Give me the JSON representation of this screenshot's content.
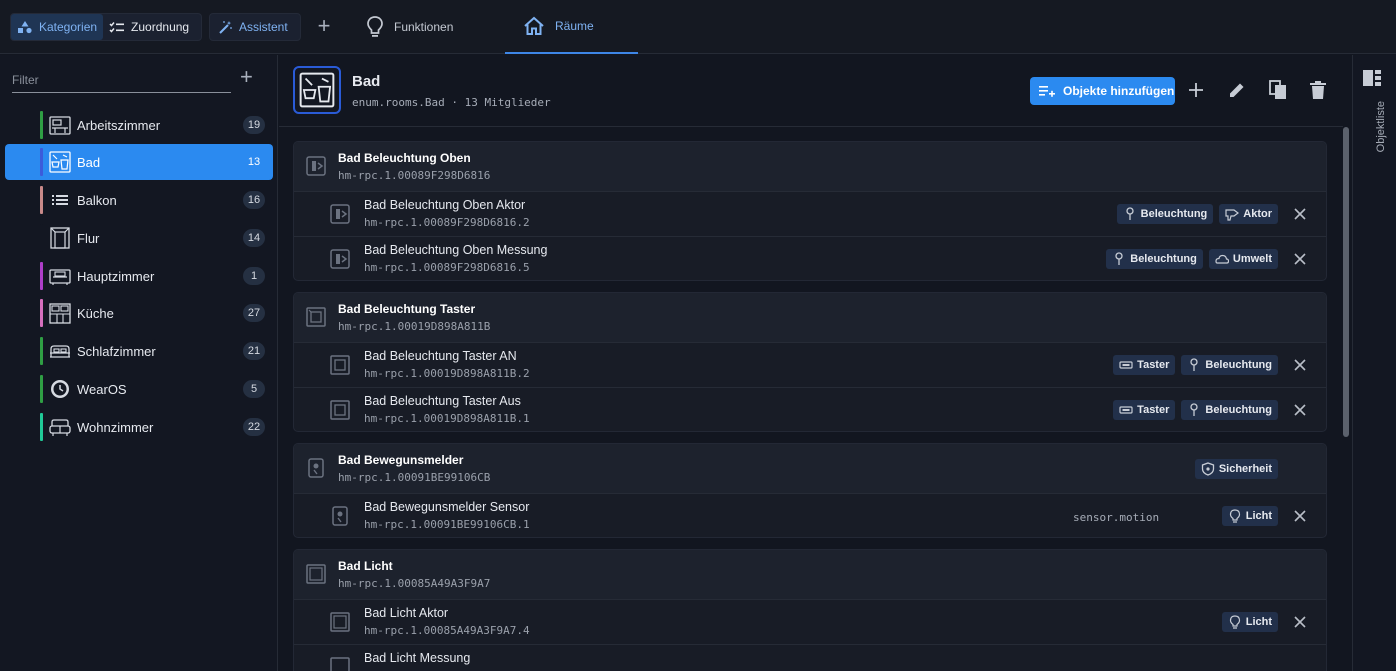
{
  "toolbar": {
    "categories_label": "Kategorien",
    "assignment_label": "Zuordnung",
    "assistant_label": "Assistent",
    "tabs": [
      {
        "label": "Funktionen",
        "icon": "lightbulb-icon"
      },
      {
        "label": "Räume",
        "icon": "home-icon"
      }
    ]
  },
  "sidebar": {
    "filter_placeholder": "Filter",
    "rooms": [
      {
        "name": "Arbeitszimmer",
        "count": "19",
        "color": "#2f9e44"
      },
      {
        "name": "Bad",
        "count": "13",
        "color": "#3b5bdb",
        "active": true
      },
      {
        "name": "Balkon",
        "count": "16",
        "color": "#c98a8a"
      },
      {
        "name": "Flur",
        "count": "14",
        "color": "#131722"
      },
      {
        "name": "Hauptzimmer",
        "count": "1",
        "color": "#ae3ec9"
      },
      {
        "name": "Küche",
        "count": "27",
        "color": "#d66fbd"
      },
      {
        "name": "Schlafzimmer",
        "count": "21",
        "color": "#2f9e44"
      },
      {
        "name": "WearOS",
        "count": "5",
        "color": "#2f9e44"
      },
      {
        "name": "Wohnzimmer",
        "count": "22",
        "color": "#20c997"
      }
    ]
  },
  "header": {
    "title": "Bad",
    "subtitle": "enum.rooms.Bad · 13 Mitglieder",
    "add_objects_label": "Objekte hinzufügen"
  },
  "rail": {
    "label": "Objektliste"
  },
  "groups": [
    {
      "title": "Bad Beleuchtung Oben",
      "id": "hm-rpc.1.00089F298D6816",
      "rows": [
        {
          "title": "Bad Beleuchtung Oben Aktor",
          "id": "hm-rpc.1.00089F298D6816.2",
          "chips": [
            {
              "label": "Beleuchtung"
            },
            {
              "label": "Aktor"
            }
          ]
        },
        {
          "title": "Bad Beleuchtung Oben Messung",
          "id": "hm-rpc.1.00089F298D6816.5",
          "chips": [
            {
              "label": "Beleuchtung"
            },
            {
              "label": "Umwelt"
            }
          ]
        }
      ]
    },
    {
      "title": "Bad Beleuchtung Taster",
      "id": "hm-rpc.1.00019D898A811B",
      "rows": [
        {
          "title": "Bad Beleuchtung Taster AN",
          "id": "hm-rpc.1.00019D898A811B.2",
          "chips": [
            {
              "label": "Taster"
            },
            {
              "label": "Beleuchtung"
            }
          ]
        },
        {
          "title": "Bad Beleuchtung Taster Aus",
          "id": "hm-rpc.1.00019D898A811B.1",
          "chips": [
            {
              "label": "Taster"
            },
            {
              "label": "Beleuchtung"
            }
          ]
        }
      ]
    },
    {
      "title": "Bad Bewegunsmelder",
      "id": "hm-rpc.1.00091BE99106CB",
      "chips": [
        {
          "label": "Sicherheit"
        }
      ],
      "rows": [
        {
          "title": "Bad Bewegunsmelder Sensor",
          "id": "hm-rpc.1.00091BE99106CB.1",
          "role": "sensor.motion",
          "chips": [
            {
              "label": "Licht"
            }
          ]
        }
      ]
    },
    {
      "title": "Bad Licht",
      "id": "hm-rpc.1.00085A49A3F9A7",
      "rows": [
        {
          "title": "Bad Licht Aktor",
          "id": "hm-rpc.1.00085A49A3F9A7.4",
          "chips": [
            {
              "label": "Licht"
            }
          ]
        },
        {
          "title": "Bad Licht Messung",
          "id": ""
        }
      ]
    }
  ]
}
